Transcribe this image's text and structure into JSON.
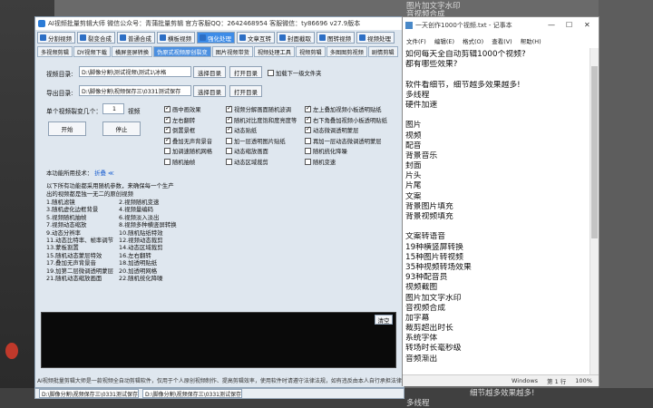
{
  "app": {
    "title": "AI视频批量剪辑大师 微信公众号：青蒲批量剪辑 官方客服QQ：2642468954 客服微信：ty86696 v27.9版本",
    "toolbar": [
      {
        "label": "分割视频",
        "active": false
      },
      {
        "label": "裂变合成",
        "active": false
      },
      {
        "label": "普通合成",
        "active": false
      },
      {
        "label": "横板视频",
        "active": false
      },
      {
        "label": "强化处理",
        "active": true
      },
      {
        "label": "文章互转",
        "active": false
      },
      {
        "label": "封面截取",
        "active": false
      },
      {
        "label": "图转视频",
        "active": false
      },
      {
        "label": "视频处理",
        "active": false
      }
    ],
    "tabs": [
      {
        "label": "多视频剪辑",
        "active": false
      },
      {
        "label": "DY视频下载",
        "active": false
      },
      {
        "label": "横屏竖屏转换",
        "active": false
      },
      {
        "label": "伪原式视频原创裂变",
        "active": true
      },
      {
        "label": "图片视频带货",
        "active": false
      },
      {
        "label": "视频处理工具",
        "active": false
      },
      {
        "label": "视频剪辑",
        "active": false
      },
      {
        "label": "多图图剪视频",
        "active": false
      },
      {
        "label": "剧情剪辑",
        "active": false
      }
    ],
    "input_dir": {
      "label": "视频目录:",
      "value": "D:\\脚像分割\\测试视频\\测试1\\冰格",
      "select_btn": "选择目录",
      "open_btn": "打开目录",
      "checkbox": "加载下一级文件夹"
    },
    "output_dir": {
      "label": "导出目录:",
      "value": "D:\\脚像分割\\视频保存三\\0331测试保存",
      "select_btn": "选择目录",
      "open_btn": "打开目录"
    },
    "count": {
      "label": "单个视频裂变几个：",
      "value": "1",
      "unit": "视频"
    },
    "start_btn": "开始",
    "stop_btn": "停止",
    "options_col1": [
      {
        "label": "画中画效果",
        "checked": true
      },
      {
        "label": "左右翻转",
        "checked": true
      },
      {
        "label": "倒置景框",
        "checked": true
      },
      {
        "label": "叠加无声背景音",
        "checked": true
      },
      {
        "label": "加调速随机网格",
        "checked": false
      },
      {
        "label": "随机抽帧",
        "checked": false
      }
    ],
    "options_col2": [
      {
        "label": "视频分解画面随机波调",
        "checked": true
      },
      {
        "label": "随机对比度饱和度亮度等",
        "checked": true
      },
      {
        "label": "动态贴纸",
        "checked": true
      },
      {
        "label": "加一层透明图片贴纸",
        "checked": false
      },
      {
        "label": "动态缩放画面",
        "checked": false
      },
      {
        "label": "动态区域裁剪",
        "checked": false
      }
    ],
    "options_col3": [
      {
        "label": "左上叠加视频小板透明贴纸",
        "checked": true
      },
      {
        "label": "右下角叠加视频小板透明贴纸",
        "checked": true
      },
      {
        "label": "动态微调透明蒙层",
        "checked": true
      },
      {
        "label": "再加一层动态微调透明蒙层",
        "checked": false
      },
      {
        "label": "随机统化降噪",
        "checked": false
      },
      {
        "label": "随机变速",
        "checked": false
      }
    ],
    "tech_label": "本功能所用技术：",
    "tech_link": "折叠",
    "intro_line1": "以下所有功能都采用随机参数，来确保每一个生产",
    "intro_line2": "出的视频都是独一无二的原创视频",
    "features_left": [
      "1.随机滤镜",
      "3.随机虚化边框背景",
      "5.视频随机抽帧",
      "7.视频动态缩放",
      "9.动态分辨率",
      "11.动态比特率、帧率调节",
      "13.蒙板割置",
      "15.随机动态蒙层特效",
      "17.叠加无声背景音",
      "19.加第二层微调透明蒙层",
      "21.随机动态缩放画面"
    ],
    "features_right": [
      "2.视频随机变速",
      "4.视频量编码",
      "6.视频淡入淡出",
      "8.视频多种横竖屏转换",
      "10.随机贴纸特效",
      "12.视频动态裁剪",
      "14.动态区域裁剪",
      "16.左右翻转",
      "18.加透明贴纸",
      "20.加透明网格",
      "22.随机统化降噪"
    ],
    "clear_btn": "清空",
    "footer": "AI视频批量剪辑大师是一款视频全自动剪辑软件，仅用于个人原创视频制作、提高剪辑效率，使用软件时请遵守法律法规，如有违反由本人自行承担法律责任！",
    "status_path1": "D:\\脚像分割\\视频保存三\\0331测试保存",
    "status_path2": "D:\\脚像分割\\视频保存三\\0331测试保存"
  },
  "notepad": {
    "title": "一天创作1000个视频.txt - 记事本",
    "menu": [
      "文件(F)",
      "编辑(E)",
      "格式(O)",
      "查看(V)",
      "帮助(H)"
    ],
    "lines": [
      "如何每天全自动剪辑1000个视频?",
      "都有哪些效果?",
      "",
      "软件看细节，细节越多效果越多!",
      "多线程",
      "硬件加速",
      "",
      "图片",
      "视频",
      "配音",
      "背景音乐",
      "封面",
      "片头",
      "片尾",
      "文案",
      "背景图片填充",
      "背景视频填充",
      "",
      "文案转语音",
      "19种横竖屏转换",
      "15种图片转视频",
      "35种视频转场效果",
      "93种配音员",
      "视频截图",
      "图片加文字水印",
      "音视频合成",
      "加字幕",
      "裁剪超出时长",
      "系统字体",
      "转场时长毫秒级",
      "音频渐出"
    ],
    "status_os": "Windows",
    "status_pos": "第 1 行",
    "status_zoom": "100%",
    "peek_top1": "图片加文字水印",
    "peek_top2": "音视频合成",
    "peek_bottom1": "细节越多效果越多!",
    "peek_bottom2": "多线程"
  }
}
